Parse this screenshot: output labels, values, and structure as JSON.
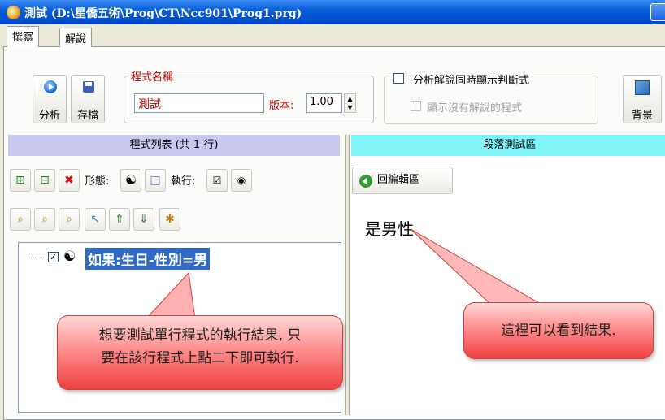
{
  "window": {
    "title": "測試 (D:\\星僑五術\\Prog\\CT\\Ncc901\\Prog1.prg)"
  },
  "tabs": [
    {
      "label": "撰寫"
    },
    {
      "label": "解說"
    }
  ],
  "toolbar": {
    "analyze_label": "分析",
    "save_label": "存檔",
    "program_name_legend": "程式名稱",
    "program_name_value": "測試",
    "version_label": "版本:",
    "version_value": "1.00",
    "sync_display_label": "分析解說同時顯示判斷式",
    "show_unexplained_label": "顯示沒有解說的程式",
    "background_label": "背景"
  },
  "left_panel": {
    "header": "程式列表 (共 1 行)",
    "form_label": "形態:",
    "execute_label": "執行:",
    "tree_item": "如果:生日-性別=男",
    "tree_item_checked": true
  },
  "right_panel": {
    "header": "段落測試區",
    "back_button": "回編輯區",
    "result_text": "是男性"
  },
  "callouts": {
    "left_line1": "想要測試單行程式的執行結果, 只",
    "left_line2": "要在該行程式上點二下即可執行.",
    "right_text": "這裡可以看到結果."
  },
  "colors": {
    "left_header_bg": "#c8c8f0",
    "right_header_bg": "#80f4f8",
    "callout": "#ee4040",
    "selection": "#316ac5",
    "red_text": "#c00000"
  }
}
